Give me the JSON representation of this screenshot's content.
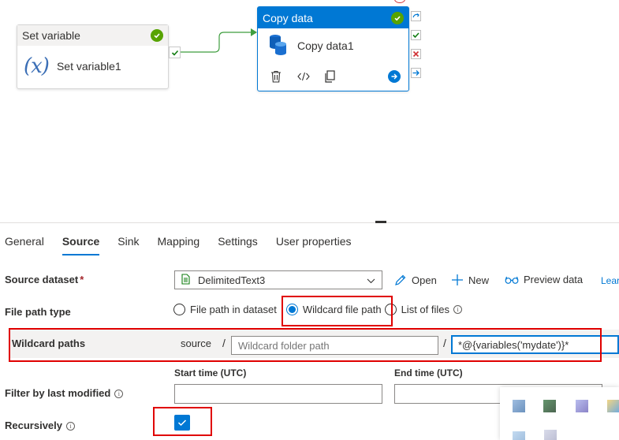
{
  "canvas": {
    "set_variable": {
      "title": "Set variable",
      "name": "Set variable1",
      "icon": "variable-fx-icon"
    },
    "copy_data": {
      "title": "Copy data",
      "name": "Copy data1",
      "icon": "database-icon",
      "accent": "#0078d4"
    },
    "colors": {
      "success": "#57a300",
      "brand": "#0078d4",
      "error": "#e00000"
    }
  },
  "tabs": [
    {
      "label": "General"
    },
    {
      "label": "Source",
      "active": true
    },
    {
      "label": "Sink"
    },
    {
      "label": "Mapping"
    },
    {
      "label": "Settings"
    },
    {
      "label": "User properties"
    }
  ],
  "source": {
    "dataset_label": "Source dataset",
    "required_mark": "*",
    "dataset_value": "DelimitedText3",
    "open_label": "Open",
    "new_label": "New",
    "preview_label": "Preview data",
    "learn_label": "Lear",
    "file_path_type_label": "File path type",
    "file_path_options": [
      {
        "label": "File path in dataset",
        "selected": false
      },
      {
        "label": "Wildcard file path",
        "selected": true
      },
      {
        "label": "List of files",
        "selected": false
      }
    ],
    "wildcard_label": "Wildcard paths",
    "wildcard_root": "source",
    "separator": "/",
    "wildcard_folder_placeholder": "Wildcard folder path",
    "wildcard_file_value": "*@{variables('mydate')}*",
    "start_time_label": "Start time (UTC)",
    "end_time_label": "End time (UTC)",
    "filter_label": "Filter by last modified",
    "recursively_label": "Recursively",
    "recursively_checked": true,
    "info_glyph": "i"
  }
}
